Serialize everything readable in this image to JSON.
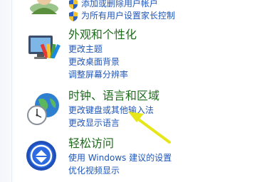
{
  "user_accounts": {
    "links": [
      {
        "label": "添加或删除用户帐户",
        "icon": "uac-shield-icon"
      },
      {
        "label": "为所有用户设置家长控制",
        "icon": "uac-shield-icon"
      }
    ]
  },
  "appearance": {
    "title": "外观和个性化",
    "icon": "appearance-personalization-icon",
    "links": [
      "更改主题",
      "更改桌面背景",
      "调整屏幕分辨率"
    ]
  },
  "clock_language": {
    "title": "时钟、语言和区域",
    "icon": "clock-globe-icon",
    "links": [
      "更改键盘或其他输入法",
      "更改显示语言"
    ]
  },
  "ease_of_access": {
    "title": "轻松访问",
    "icon": "ease-of-access-icon",
    "links": [
      "使用 Windows 建议的设置",
      "优化视频显示"
    ]
  },
  "annotation": {
    "color": "#e6e61a",
    "icon": "yellow-arrow-icon"
  }
}
